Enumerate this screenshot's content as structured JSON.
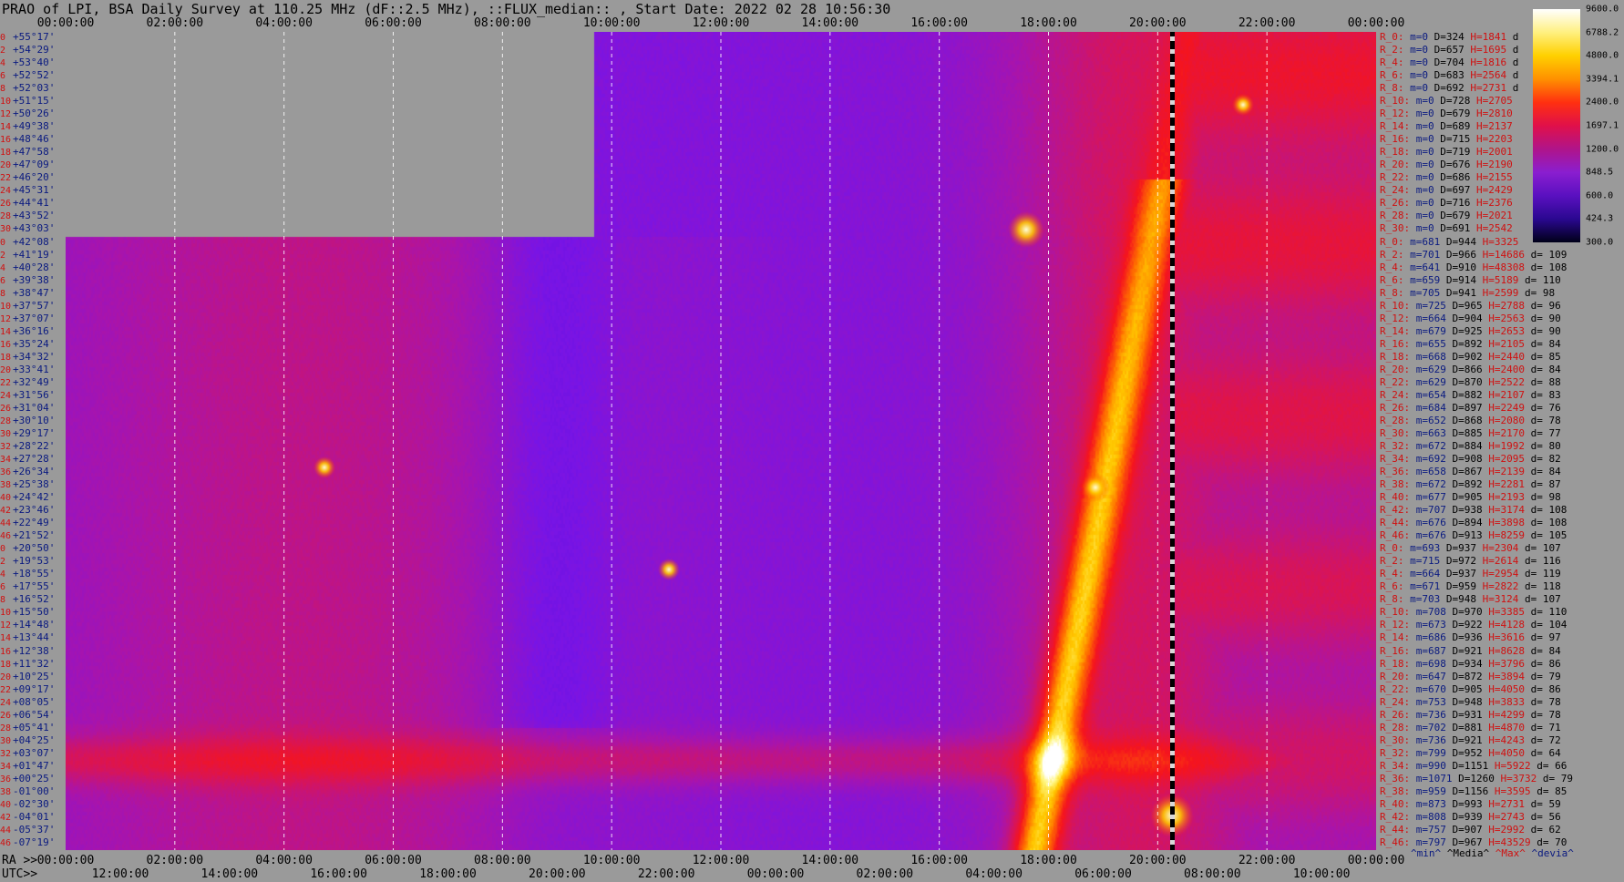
{
  "title": "PRAO of LPI, BSA Daily Survey at 110.25 MHz (dF::2.5 MHz), ::FLUX_median:: , Start Date: 2022 02 28 10:56:30",
  "top_axis": [
    "00:00:00",
    "02:00:00",
    "04:00:00",
    "06:00:00",
    "08:00:00",
    "10:00:00",
    "12:00:00",
    "14:00:00",
    "16:00:00",
    "18:00:00",
    "20:00:00",
    "22:00:00",
    "00:00:00"
  ],
  "bottom_axis": {
    "ra_label": "RA >>",
    "ra_ticks": [
      "00:00:00",
      "02:00:00",
      "04:00:00",
      "06:00:00",
      "08:00:00",
      "10:00:00",
      "12:00:00",
      "14:00:00",
      "16:00:00",
      "18:00:00",
      "20:00:00",
      "22:00:00",
      "00:00:00"
    ],
    "utc_label": "UTC>>",
    "utc_ticks": [
      "12:00:00",
      "14:00:00",
      "16:00:00",
      "18:00:00",
      "20:00:00",
      "22:00:00",
      "00:00:00",
      "02:00:00",
      "04:00:00",
      "06:00:00",
      "08:00:00",
      "10:00:00"
    ]
  },
  "declinations": [
    {
      "i": "0",
      "d": "+55°17'"
    },
    {
      "i": "2",
      "d": "+54°29'"
    },
    {
      "i": "4",
      "d": "+53°40'"
    },
    {
      "i": "6",
      "d": "+52°52'"
    },
    {
      "i": "8",
      "d": "+52°03'"
    },
    {
      "i": "10",
      "d": "+51°15'"
    },
    {
      "i": "12",
      "d": "+50°26'"
    },
    {
      "i": "14",
      "d": "+49°38'"
    },
    {
      "i": "16",
      "d": "+48°46'"
    },
    {
      "i": "18",
      "d": "+47°58'"
    },
    {
      "i": "20",
      "d": "+47°09'"
    },
    {
      "i": "22",
      "d": "+46°20'"
    },
    {
      "i": "24",
      "d": "+45°31'"
    },
    {
      "i": "26",
      "d": "+44°41'"
    },
    {
      "i": "28",
      "d": "+43°52'"
    },
    {
      "i": "30",
      "d": "+43°03'"
    },
    {
      "i": "0",
      "d": "+42°08'"
    },
    {
      "i": "2",
      "d": "+41°19'"
    },
    {
      "i": "4",
      "d": "+40°28'"
    },
    {
      "i": "6",
      "d": "+39°38'"
    },
    {
      "i": "8",
      "d": "+38°47'"
    },
    {
      "i": "10",
      "d": "+37°57'"
    },
    {
      "i": "12",
      "d": "+37°07'"
    },
    {
      "i": "14",
      "d": "+36°16'"
    },
    {
      "i": "16",
      "d": "+35°24'"
    },
    {
      "i": "18",
      "d": "+34°32'"
    },
    {
      "i": "20",
      "d": "+33°41'"
    },
    {
      "i": "22",
      "d": "+32°49'"
    },
    {
      "i": "24",
      "d": "+31°56'"
    },
    {
      "i": "26",
      "d": "+31°04'"
    },
    {
      "i": "28",
      "d": "+30°10'"
    },
    {
      "i": "30",
      "d": "+29°17'"
    },
    {
      "i": "32",
      "d": "+28°22'"
    },
    {
      "i": "34",
      "d": "+27°28'"
    },
    {
      "i": "36",
      "d": "+26°34'"
    },
    {
      "i": "38",
      "d": "+25°38'"
    },
    {
      "i": "40",
      "d": "+24°42'"
    },
    {
      "i": "42",
      "d": "+23°46'"
    },
    {
      "i": "44",
      "d": "+22°49'"
    },
    {
      "i": "46",
      "d": "+21°52'"
    },
    {
      "i": "0",
      "d": "+20°50'"
    },
    {
      "i": "2",
      "d": "+19°53'"
    },
    {
      "i": "4",
      "d": "+18°55'"
    },
    {
      "i": "6",
      "d": "+17°55'"
    },
    {
      "i": "8",
      "d": "+16°52'"
    },
    {
      "i": "10",
      "d": "+15°50'"
    },
    {
      "i": "12",
      "d": "+14°48'"
    },
    {
      "i": "14",
      "d": "+13°44'"
    },
    {
      "i": "16",
      "d": "+12°38'"
    },
    {
      "i": "18",
      "d": "+11°32'"
    },
    {
      "i": "20",
      "d": "+10°25'"
    },
    {
      "i": "22",
      "d": "+09°17'"
    },
    {
      "i": "24",
      "d": "+08°05'"
    },
    {
      "i": "26",
      "d": "+06°54'"
    },
    {
      "i": "28",
      "d": "+05°41'"
    },
    {
      "i": "30",
      "d": "+04°25'"
    },
    {
      "i": "32",
      "d": "+03°07'"
    },
    {
      "i": "34",
      "d": "+01°47'"
    },
    {
      "i": "36",
      "d": "+00°25'"
    },
    {
      "i": "38",
      "d": "-01°00'"
    },
    {
      "i": "40",
      "d": "-02°30'"
    },
    {
      "i": "42",
      "d": "-04°01'"
    },
    {
      "i": "44",
      "d": "-05°37'"
    },
    {
      "i": "46",
      "d": "-07°19'"
    }
  ],
  "stats": [
    {
      "r": "R_0:",
      "m": "m=0",
      "D": "D=324",
      "H": "H=1841",
      "d": "d"
    },
    {
      "r": "R_2:",
      "m": "m=0",
      "D": "D=657",
      "H": "H=1695",
      "d": "d"
    },
    {
      "r": "R_4:",
      "m": "m=0",
      "D": "D=704",
      "H": "H=1816",
      "d": "d"
    },
    {
      "r": "R_6:",
      "m": "m=0",
      "D": "D=683",
      "H": "H=2564",
      "d": "d"
    },
    {
      "r": "R_8:",
      "m": "m=0",
      "D": "D=692",
      "H": "H=2731",
      "d": "d"
    },
    {
      "r": "R_10:",
      "m": "m=0",
      "D": "D=728",
      "H": "H=2705",
      "d": ""
    },
    {
      "r": "R_12:",
      "m": "m=0",
      "D": "D=679",
      "H": "H=2810",
      "d": ""
    },
    {
      "r": "R_14:",
      "m": "m=0",
      "D": "D=689",
      "H": "H=2137",
      "d": ""
    },
    {
      "r": "R_16:",
      "m": "m=0",
      "D": "D=715",
      "H": "H=2203",
      "d": ""
    },
    {
      "r": "R_18:",
      "m": "m=0",
      "D": "D=719",
      "H": "H=2001",
      "d": ""
    },
    {
      "r": "R_20:",
      "m": "m=0",
      "D": "D=676",
      "H": "H=2190",
      "d": ""
    },
    {
      "r": "R_22:",
      "m": "m=0",
      "D": "D=686",
      "H": "H=2155",
      "d": ""
    },
    {
      "r": "R_24:",
      "m": "m=0",
      "D": "D=697",
      "H": "H=2429",
      "d": ""
    },
    {
      "r": "R_26:",
      "m": "m=0",
      "D": "D=716",
      "H": "H=2376",
      "d": ""
    },
    {
      "r": "R_28:",
      "m": "m=0",
      "D": "D=679",
      "H": "H=2021",
      "d": ""
    },
    {
      "r": "R_30:",
      "m": "m=0",
      "D": "D=691",
      "H": "H=2542",
      "d": ""
    },
    {
      "r": "R_0:",
      "m": "m=681",
      "D": "D=944",
      "H": "H=3325",
      "d": ""
    },
    {
      "r": "R_2:",
      "m": "m=701",
      "D": "D=966",
      "H": "H=14686",
      "d": "d= 109"
    },
    {
      "r": "R_4:",
      "m": "m=641",
      "D": "D=910",
      "H": "H=48308",
      "d": "d= 108"
    },
    {
      "r": "R_6:",
      "m": "m=659",
      "D": "D=914",
      "H": "H=5189",
      "d": "d= 110"
    },
    {
      "r": "R_8:",
      "m": "m=705",
      "D": "D=941",
      "H": "H=2599",
      "d": "d= 98"
    },
    {
      "r": "R_10:",
      "m": "m=725",
      "D": "D=965",
      "H": "H=2788",
      "d": "d= 96"
    },
    {
      "r": "R_12:",
      "m": "m=664",
      "D": "D=904",
      "H": "H=2563",
      "d": "d= 90"
    },
    {
      "r": "R_14:",
      "m": "m=679",
      "D": "D=925",
      "H": "H=2653",
      "d": "d= 90"
    },
    {
      "r": "R_16:",
      "m": "m=655",
      "D": "D=892",
      "H": "H=2105",
      "d": "d= 84"
    },
    {
      "r": "R_18:",
      "m": "m=668",
      "D": "D=902",
      "H": "H=2440",
      "d": "d= 85"
    },
    {
      "r": "R_20:",
      "m": "m=629",
      "D": "D=866",
      "H": "H=2400",
      "d": "d= 84"
    },
    {
      "r": "R_22:",
      "m": "m=629",
      "D": "D=870",
      "H": "H=2522",
      "d": "d= 88"
    },
    {
      "r": "R_24:",
      "m": "m=654",
      "D": "D=882",
      "H": "H=2107",
      "d": "d= 83"
    },
    {
      "r": "R_26:",
      "m": "m=684",
      "D": "D=897",
      "H": "H=2249",
      "d": "d= 76"
    },
    {
      "r": "R_28:",
      "m": "m=652",
      "D": "D=868",
      "H": "H=2080",
      "d": "d= 78"
    },
    {
      "r": "R_30:",
      "m": "m=663",
      "D": "D=885",
      "H": "H=2170",
      "d": "d= 77"
    },
    {
      "r": "R_32:",
      "m": "m=672",
      "D": "D=884",
      "H": "H=1992",
      "d": "d= 80"
    },
    {
      "r": "R_34:",
      "m": "m=692",
      "D": "D=908",
      "H": "H=2095",
      "d": "d= 82"
    },
    {
      "r": "R_36:",
      "m": "m=658",
      "D": "D=867",
      "H": "H=2139",
      "d": "d= 84"
    },
    {
      "r": "R_38:",
      "m": "m=672",
      "D": "D=892",
      "H": "H=2281",
      "d": "d= 87"
    },
    {
      "r": "R_40:",
      "m": "m=677",
      "D": "D=905",
      "H": "H=2193",
      "d": "d= 98"
    },
    {
      "r": "R_42:",
      "m": "m=707",
      "D": "D=938",
      "H": "H=3174",
      "d": "d= 108"
    },
    {
      "r": "R_44:",
      "m": "m=676",
      "D": "D=894",
      "H": "H=3898",
      "d": "d= 108"
    },
    {
      "r": "R_46:",
      "m": "m=676",
      "D": "D=913",
      "H": "H=8259",
      "d": "d= 105"
    },
    {
      "r": "R_0:",
      "m": "m=693",
      "D": "D=937",
      "H": "H=2304",
      "d": "d= 107"
    },
    {
      "r": "R_2:",
      "m": "m=715",
      "D": "D=972",
      "H": "H=2614",
      "d": "d= 116"
    },
    {
      "r": "R_4:",
      "m": "m=664",
      "D": "D=937",
      "H": "H=2954",
      "d": "d= 119"
    },
    {
      "r": "R_6:",
      "m": "m=671",
      "D": "D=959",
      "H": "H=2822",
      "d": "d= 118"
    },
    {
      "r": "R_8:",
      "m": "m=703",
      "D": "D=948",
      "H": "H=3124",
      "d": "d= 107"
    },
    {
      "r": "R_10:",
      "m": "m=708",
      "D": "D=970",
      "H": "H=3385",
      "d": "d= 110"
    },
    {
      "r": "R_12:",
      "m": "m=673",
      "D": "D=922",
      "H": "H=4128",
      "d": "d= 104"
    },
    {
      "r": "R_14:",
      "m": "m=686",
      "D": "D=936",
      "H": "H=3616",
      "d": "d= 97"
    },
    {
      "r": "R_16:",
      "m": "m=687",
      "D": "D=921",
      "H": "H=8628",
      "d": "d= 84"
    },
    {
      "r": "R_18:",
      "m": "m=698",
      "D": "D=934",
      "H": "H=3796",
      "d": "d= 86"
    },
    {
      "r": "R_20:",
      "m": "m=647",
      "D": "D=872",
      "H": "H=3894",
      "d": "d= 79"
    },
    {
      "r": "R_22:",
      "m": "m=670",
      "D": "D=905",
      "H": "H=4050",
      "d": "d= 86"
    },
    {
      "r": "R_24:",
      "m": "m=753",
      "D": "D=948",
      "H": "H=3833",
      "d": "d= 78"
    },
    {
      "r": "R_26:",
      "m": "m=736",
      "D": "D=931",
      "H": "H=4299",
      "d": "d= 78"
    },
    {
      "r": "R_28:",
      "m": "m=702",
      "D": "D=881",
      "H": "H=4870",
      "d": "d= 71"
    },
    {
      "r": "R_30:",
      "m": "m=736",
      "D": "D=921",
      "H": "H=4243",
      "d": "d= 72"
    },
    {
      "r": "R_32:",
      "m": "m=799",
      "D": "D=952",
      "H": "H=4050",
      "d": "d= 64"
    },
    {
      "r": "R_34:",
      "m": "m=990",
      "D": "D=1151",
      "H": "H=5922",
      "d": "d= 66"
    },
    {
      "r": "R_36:",
      "m": "m=1071",
      "D": "D=1260",
      "H": "H=3732",
      "d": "d= 79"
    },
    {
      "r": "R_38:",
      "m": "m=959",
      "D": "D=1156",
      "H": "H=3595",
      "d": "d= 85"
    },
    {
      "r": "R_40:",
      "m": "m=873",
      "D": "D=993",
      "H": "H=2731",
      "d": "d= 59"
    },
    {
      "r": "R_42:",
      "m": "m=808",
      "D": "D=939",
      "H": "H=2743",
      "d": "d= 56"
    },
    {
      "r": "R_44:",
      "m": "m=757",
      "D": "D=907",
      "H": "H=2992",
      "d": "d= 62"
    },
    {
      "r": "R_46:",
      "m": "m=797",
      "D": "D=967",
      "H": "H=43529",
      "d": "d= 70"
    }
  ],
  "stats_footer": {
    "min": "^min^",
    "median": "^Media^",
    "max": "^Max^",
    "devia": "^devia^"
  },
  "colorbar": {
    "labels": [
      "9600.0",
      "6788.2",
      "4800.0",
      "3394.1",
      "2400.0",
      "1697.1",
      "1200.0",
      "848.5",
      "600.0",
      "424.3",
      "300.0"
    ],
    "colors": [
      "#ffffff",
      "#fff080",
      "#ffd000",
      "#ff9000",
      "#ff3010",
      "#e0104a",
      "#b0148a",
      "#8a1ed0",
      "#5a10c0",
      "#2a0890",
      "#000018"
    ]
  },
  "chart_data": {
    "type": "heatmap",
    "title": "PRAO of LPI, BSA Daily Survey at 110.25 MHz (dF::2.5 MHz), ::FLUX_median:: , Start Date: 2022 02 28 10:56:30",
    "x_axis_ra": [
      "00:00:00",
      "02:00:00",
      "04:00:00",
      "06:00:00",
      "08:00:00",
      "10:00:00",
      "12:00:00",
      "14:00:00",
      "16:00:00",
      "18:00:00",
      "20:00:00",
      "22:00:00",
      "00:00:00"
    ],
    "x_axis_utc": [
      "12:00:00",
      "14:00:00",
      "16:00:00",
      "18:00:00",
      "20:00:00",
      "22:00:00",
      "00:00:00",
      "02:00:00",
      "04:00:00",
      "06:00:00",
      "08:00:00",
      "10:00:00"
    ],
    "y_axis": "declination",
    "colorscale_range": [
      300.0,
      9600.0
    ],
    "colorscale": "log"
  }
}
